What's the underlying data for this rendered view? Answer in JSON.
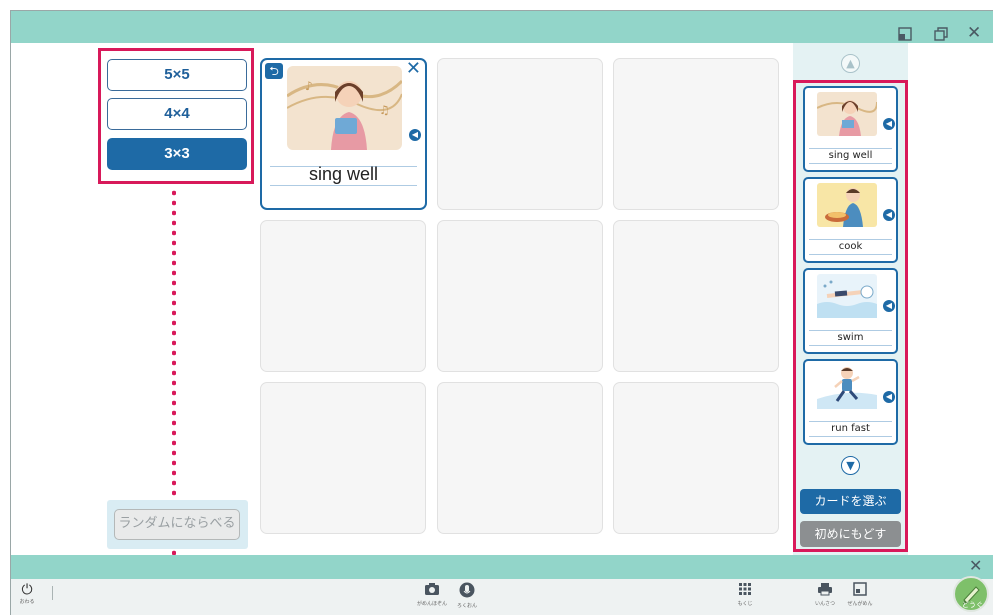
{
  "window": {
    "controls": [
      "minimize-icon",
      "restore-icon",
      "close-icon"
    ],
    "close_glyph": "✕"
  },
  "grid_options": [
    {
      "label": "5×5"
    },
    {
      "label": "4×4"
    },
    {
      "label": "3×3",
      "selected": true
    }
  ],
  "random_button": "ランダムにならべる",
  "placed_card": {
    "word": "sing well",
    "image": "girl-singing-illustration"
  },
  "card_list": [
    {
      "word": "sing well",
      "image": "girl-singing-illustration"
    },
    {
      "word": "cook",
      "image": "boy-cooking-illustration"
    },
    {
      "word": "swim",
      "image": "person-swimming-illustration"
    },
    {
      "word": "run fast",
      "image": "boy-running-illustration"
    }
  ],
  "right_buttons": {
    "choose": "カードを選ぶ",
    "reset": "初めにもどす"
  },
  "toolbar": {
    "quit": "おわる",
    "camera": "がめんほぞん",
    "record": "ろくおん",
    "contents": "もくじ",
    "print": "いんさつ",
    "fullscreen": "ぜんがめん",
    "tools": "どうぐ"
  },
  "colors": {
    "teal": "#92d5c9",
    "accent_blue": "#1e6aa6",
    "highlight_red": "#d8195a"
  }
}
